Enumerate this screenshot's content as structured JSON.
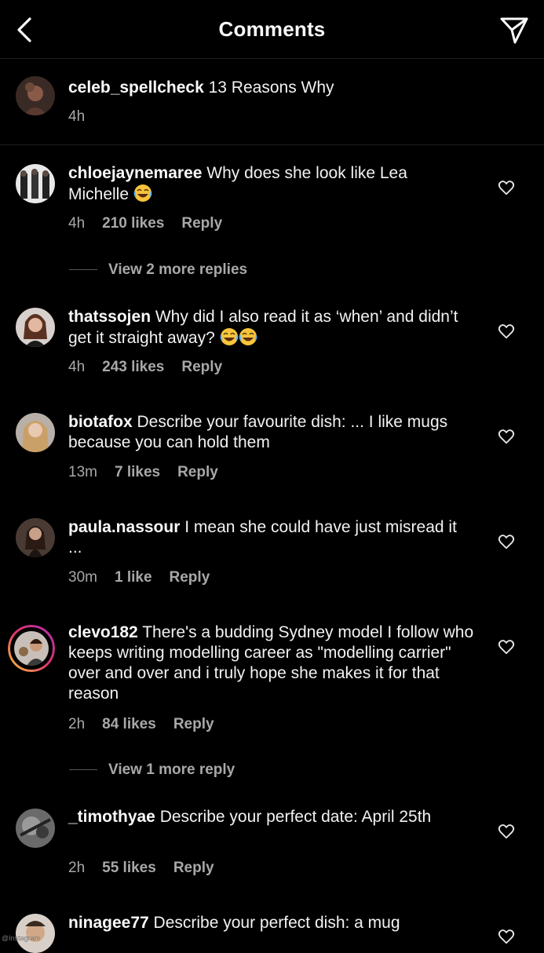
{
  "header": {
    "title": "Comments",
    "back_icon": "chevron-left-icon",
    "send_icon": "paper-plane-icon"
  },
  "caption": {
    "username": "celeb_spellcheck",
    "text": " 13 Reasons Why",
    "time": "4h"
  },
  "comments": [
    {
      "username": "chloejaynemaree",
      "text": " Why does she look like Lea Michelle ",
      "time": "4h",
      "likes": "210 likes",
      "reply": "Reply",
      "view_replies": "View 2 more replies"
    },
    {
      "username": "thatssojen",
      "text": " Why did I also read it as ‘when’ and didn’t get it straight away? ",
      "time": "4h",
      "likes": "243 likes",
      "reply": "Reply"
    },
    {
      "username": "biotafox",
      "text": " Describe your favourite dish: ... I like mugs because you can hold them",
      "time": "13m",
      "likes": "7 likes",
      "reply": "Reply"
    },
    {
      "username": "paula.nassour",
      "text": " I mean she could have just misread it ...",
      "time": "30m",
      "likes": "1 like",
      "reply": "Reply"
    },
    {
      "username": "clevo182",
      "text": " There's a budding Sydney model I follow who keeps writing modelling career as \"modelling carrier\" over and over and i truly hope she makes it for that reason",
      "time": "2h",
      "likes": "84 likes",
      "reply": "Reply",
      "view_replies": "View 1 more reply"
    },
    {
      "username": "_timothyae",
      "text": " Describe your perfect date: April 25th",
      "time": "2h",
      "likes": "55 likes",
      "reply": "Reply"
    },
    {
      "username": "ninagee77",
      "text": " Describe your perfect dish: a mug"
    }
  ],
  "watermark": "@Instagram",
  "colors": {
    "background": "#000000",
    "text": "#f5f5f5",
    "secondary_text": "#a8a8a8",
    "divider": "#1f1f1f"
  }
}
